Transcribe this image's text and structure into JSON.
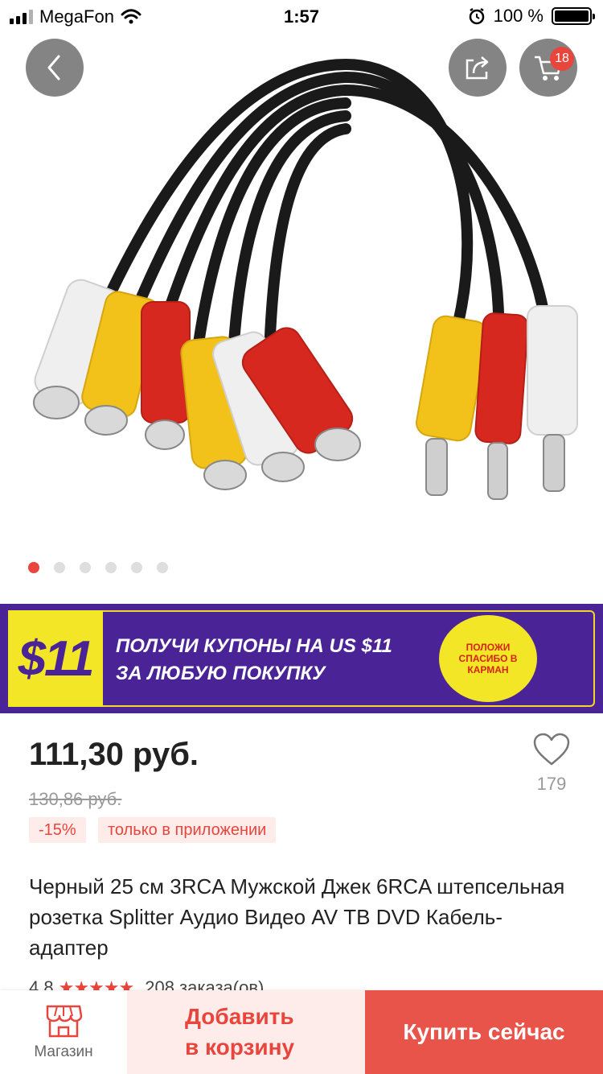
{
  "status_bar": {
    "carrier": "MegaFon",
    "time": "1:57",
    "battery": "100 %"
  },
  "header": {
    "cart_badge": "18"
  },
  "gallery": {
    "image_count": 6,
    "active_index": 0
  },
  "banner": {
    "amount": "$11",
    "line1": "ПОЛУЧИ КУПОНЫ НА US $11",
    "line2": "ЗА ЛЮБУЮ ПОКУПКУ",
    "seal_text": "ПОЛОЖИ СПАСИБО В КАРМАН"
  },
  "product": {
    "price": "111,30 руб.",
    "old_price": "130,86 руб.",
    "discount": "-15%",
    "app_only": "только в приложении",
    "favorites": "179",
    "title": "Черный 25 см 3RCA Мужской Джек 6RCA штепсельная розетка Splitter Аудио Видео AV ТВ DVD Кабель-адаптер",
    "rating": "4.8",
    "stars": "★★★★★",
    "orders": "208 заказа(ов)"
  },
  "bottom_bar": {
    "shop_label": "Магазин",
    "add_to_cart": "Добавить в корзину",
    "buy_now": "Купить сейчас"
  },
  "colors": {
    "accent": "#e8453c",
    "banner_bg": "#4a2496",
    "banner_yellow": "#f3e626"
  }
}
